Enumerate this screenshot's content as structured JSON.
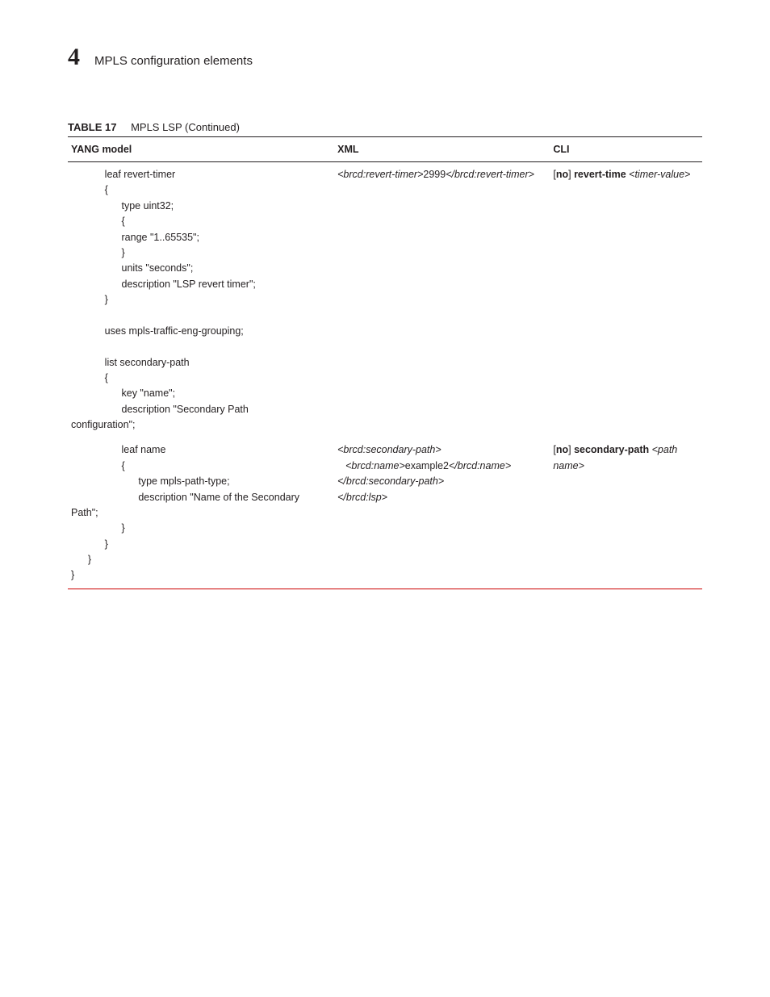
{
  "header": {
    "chapter_number": "4",
    "section_title": "MPLS configuration elements"
  },
  "table": {
    "label": "TABLE 17",
    "title": "MPLS LSP  (Continued)",
    "columns": {
      "yang": "YANG model",
      "xml": "XML",
      "cli": "CLI"
    },
    "rows": [
      {
        "yang": "            leaf revert-timer\n            {\n                  type uint32;\n                  {\n                  range \"1..65535\";\n                  }\n                  units \"seconds\";\n                  description \"LSP revert timer\";\n            }\n\n            uses mpls-traffic-eng-grouping;\n\n            list secondary-path\n            {\n                  key \"name\";\n                  description \"Secondary Path\nconfiguration\";",
        "xml": {
          "open": "<brcd:revert-timer>",
          "value": "2999",
          "close": "</brcd:revert-timer>"
        },
        "cli": {
          "no": "[no]",
          "cmd": " revert-time ",
          "arg": "<timer-value>"
        }
      },
      {
        "yang": "                  leaf name\n                  {\n                        type mpls-path-type;\n                        description \"Name of the Secondary\nPath\";\n                  }\n            }\n      }\n}",
        "xml": {
          "l1": "<brcd:secondary-path>",
          "l2o": "<brcd:name>",
          "l2v": "example2",
          "l2c": "</brcd:name>",
          "l3": "</brcd:secondary-path>",
          "l4": "</brcd:lsp>"
        },
        "cli": {
          "no": "[no]",
          "cmd": " secondary-path ",
          "arg": "<path name>"
        }
      }
    ]
  }
}
